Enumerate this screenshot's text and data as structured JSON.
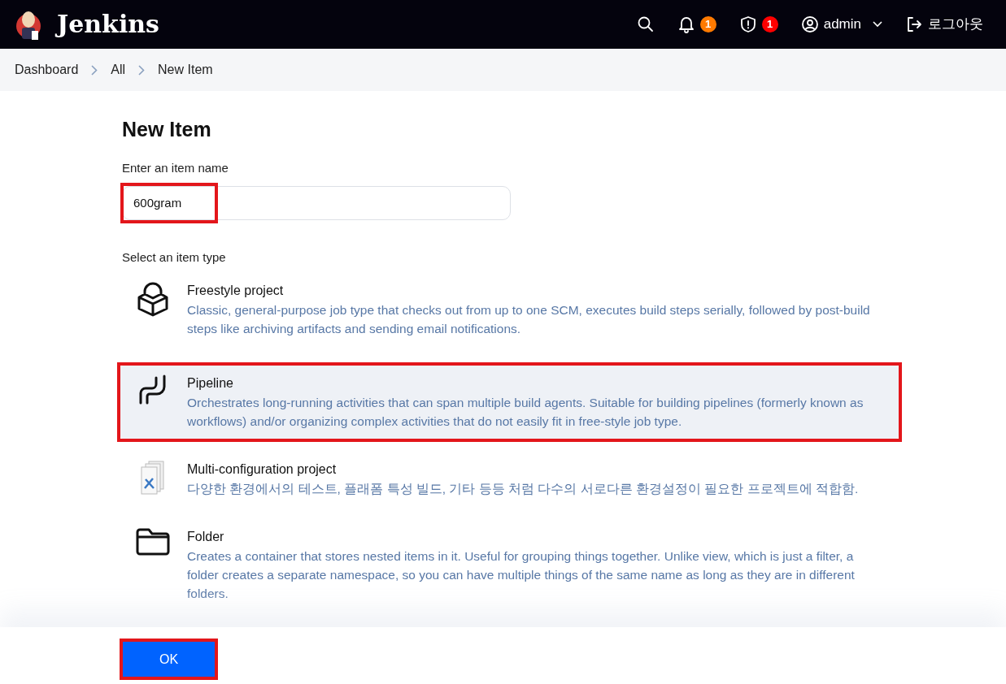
{
  "header": {
    "brand": "Jenkins",
    "actions": [
      {
        "kind": "search"
      },
      {
        "kind": "bell",
        "badge": "1",
        "color": "#ff7a00"
      },
      {
        "kind": "shield",
        "badge": "1",
        "color": "#ff0000"
      },
      {
        "kind": "user",
        "label": "admin"
      },
      {
        "kind": "logout",
        "label": "로그아웃"
      }
    ]
  },
  "breadcrumbs": [
    "Dashboard",
    "All",
    "New Item"
  ],
  "title": "New Item",
  "name_field": {
    "label": "Enter an item name",
    "value": "600gram",
    "highlighted": true
  },
  "type_label": "Select an item type",
  "item_types": [
    {
      "kind": "cube",
      "name": "Freestyle project",
      "description": "Classic, general-purpose job type that checks out from up to one SCM, executes build steps serially, followed by post-build steps like archiving artifacts and sending email notifications.",
      "selected": false,
      "highlighted": false
    },
    {
      "kind": "pipeline",
      "name": "Pipeline",
      "description": "Orchestrates long-running activities that can span multiple build agents. Suitable for building pipelines (formerly known as workflows) and/or organizing complex activities that do not easily fit in free-style job type.",
      "selected": true,
      "highlighted": true
    },
    {
      "kind": "multi",
      "name": "Multi-configuration project",
      "description": "다양한 환경에서의 테스트, 플래폼 특성 빌드, 기타 등등 처럼 다수의 서로다른 환경설정이 필요한 프로젝트에 적합함.",
      "selected": false,
      "highlighted": false
    },
    {
      "kind": "folder",
      "name": "Folder",
      "description": "Creates a container that stores nested items in it. Useful for grouping things together. Unlike view, which is just a filter, a folder creates a separate namespace, so you can have multiple things of the same name as long as they are in different folders.",
      "selected": false,
      "highlighted": false
    }
  ],
  "ok_button": {
    "label": "OK",
    "highlighted": true
  }
}
